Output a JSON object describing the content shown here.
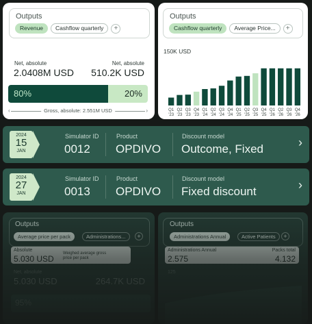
{
  "left_card": {
    "outputs_title": "Outputs",
    "chips": [
      "Revenue",
      "Cashflow quarterly"
    ],
    "net_left_label": "Net, absolute",
    "net_left_value": "2.0408M USD",
    "net_right_label": "Net, absolute",
    "net_right_value": "510.2K USD",
    "split_left": "80%",
    "split_right": "20%",
    "split_left_fraction": 0.8,
    "gross_label": "Gross, absolute: 2.551M USD"
  },
  "right_card": {
    "outputs_title": "Outputs",
    "chips": [
      "Cashflow quarterly",
      "Average Price..."
    ],
    "chart_ylabel": "150K USD"
  },
  "chart_data": {
    "type": "bar",
    "title": "",
    "ylabel": "150K USD",
    "categories": [
      "Q1 '23",
      "Q2 '23",
      "Q3 '23",
      "Q4 '23",
      "Q1 '24",
      "Q2 '24",
      "Q3 '24",
      "Q4 '24",
      "Q1 '25",
      "Q2 '25",
      "Q3 '25",
      "Q4 '25",
      "Q1 '26",
      "Q2 '26",
      "Q3 '26",
      "Q4 '26"
    ],
    "tick_top": [
      "Q1",
      "Q2",
      "Q3",
      "Q4",
      "Q1",
      "Q2",
      "Q3",
      "Q4",
      "Q1",
      "Q2",
      "Q3",
      "Q4",
      "Q1",
      "Q2",
      "Q3",
      "Q4"
    ],
    "tick_bottom": [
      "'23",
      "'23",
      "'23",
      "'23",
      "'24",
      "'24",
      "'24",
      "'24",
      "'25",
      "'25",
      "'25",
      "'25",
      "'26",
      "'26",
      "'26",
      "'26"
    ],
    "values": [
      24,
      32,
      33,
      42,
      50,
      52,
      60,
      76,
      88,
      90,
      98,
      113,
      113,
      113,
      113,
      113
    ],
    "highlight": [
      false,
      false,
      false,
      true,
      false,
      false,
      false,
      false,
      false,
      false,
      true,
      false,
      false,
      false,
      false,
      false
    ],
    "ylim": [
      0,
      150
    ],
    "colors": {
      "bar": "#0f4a3b",
      "highlight": "#bfe3bf"
    }
  },
  "simulations": [
    {
      "year": "2024",
      "day": "15",
      "month": "JAN",
      "sim_label": "Simulator ID",
      "sim_value": "0012",
      "product_label": "Product",
      "product_value": "OPDIVO",
      "discount_label": "Discount model",
      "discount_value": "Outcome, Fixed"
    },
    {
      "year": "2024",
      "day": "27",
      "month": "JAN",
      "sim_label": "Simulator ID",
      "sim_value": "0013",
      "product_label": "Product",
      "product_value": "OPDIVO",
      "discount_label": "Discount model",
      "discount_value": "Fixed discount"
    }
  ],
  "bottom_left": {
    "outputs_title": "Outputs",
    "chips": [
      "Average price per pack",
      "Administrations..."
    ],
    "absolute_label": "Absolute",
    "absolute_value": "5.030 USD",
    "weighted_label": "Weighed average gross price per pack",
    "net_left_label": "Net, absolute",
    "net_left_value": "5.030 USD",
    "net_right_value": "264.7K USD",
    "split_left": "95%"
  },
  "bottom_right": {
    "outputs_title": "Outputs",
    "chips": [
      "Administrations Annual",
      "Active Patients"
    ],
    "admin_label": "Administrations Annual",
    "admin_value": "2.575",
    "packs_label": "Packs total",
    "packs_value": "4.132",
    "axis_value": "125"
  },
  "icons": {
    "plus": "+",
    "chevron": "›"
  }
}
